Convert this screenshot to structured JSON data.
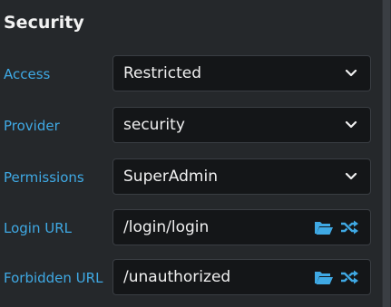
{
  "section": {
    "title": "Security"
  },
  "fields": [
    {
      "label": "Access",
      "value": "Restricted"
    },
    {
      "label": "Provider",
      "value": "security"
    },
    {
      "label": "Permissions",
      "value": "SuperAdmin"
    },
    {
      "label": "Login URL",
      "value": "/login/login"
    },
    {
      "label": "Forbidden URL",
      "value": "/unauthorized"
    }
  ],
  "icons": {
    "dropdown": "chevron-down-icon",
    "browse": "folder-open-icon",
    "random": "shuffle-icon"
  },
  "colors": {
    "background": "#25282b",
    "label": "#3fa9e4",
    "input_bg": "#141618",
    "accent_icon": "#3fa9e4",
    "text": "#f0f0f0"
  }
}
